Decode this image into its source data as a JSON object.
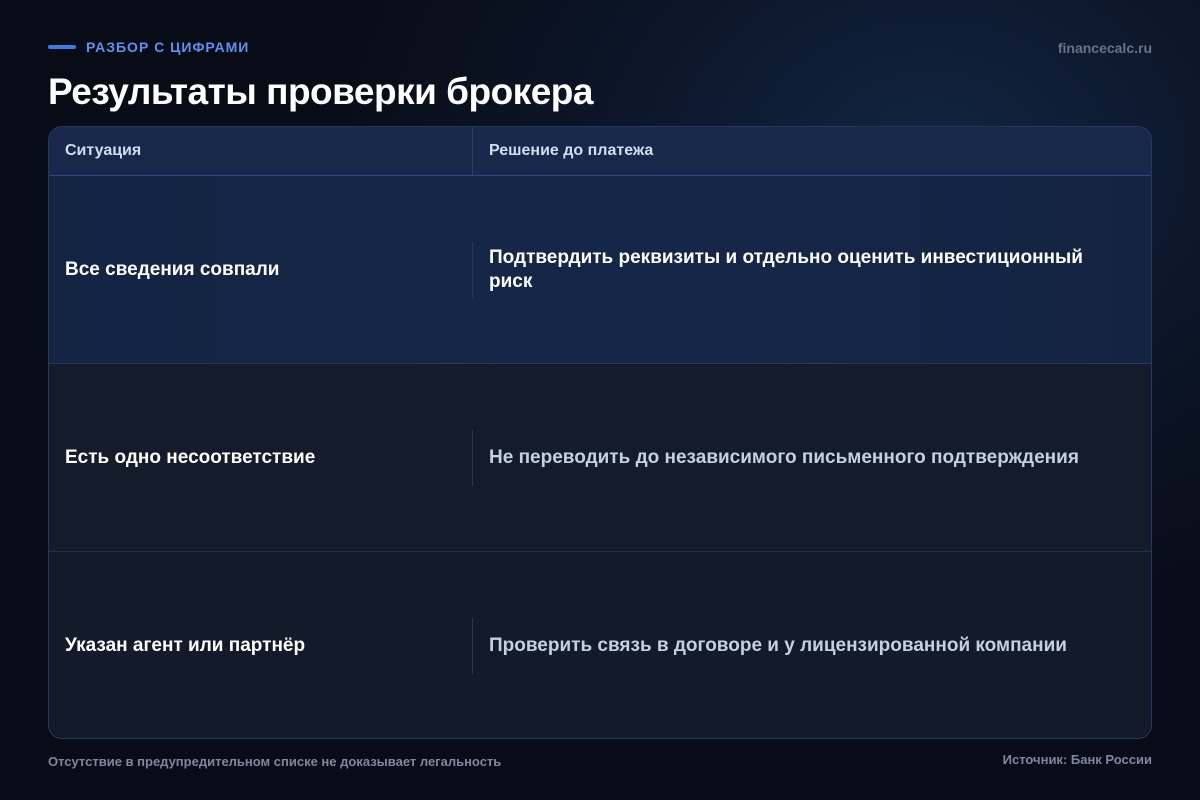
{
  "header": {
    "eyebrow": "РАЗБОР С ЦИФРАМИ",
    "site": "financecalc.ru",
    "title": "Результаты проверки брокера"
  },
  "table": {
    "columns": [
      "Ситуация",
      "Решение до платежа"
    ],
    "rows": [
      {
        "situation": "Все сведения совпали",
        "decision": "Подтвердить реквизиты и отдельно оценить инвестиционный риск"
      },
      {
        "situation": "Есть одно несоответствие",
        "decision": "Не переводить до независимого письменного подтверждения"
      },
      {
        "situation": "Указан агент или партнёр",
        "decision": "Проверить связь в договоре и у лицензированной компании"
      }
    ]
  },
  "footer": {
    "note": "Отсутствие в предупредительном списке не доказывает легальность",
    "source": "Источник: Банк России"
  },
  "colors": {
    "accent": "#3d7be6",
    "background": "#080c16",
    "highlight_row": "#152749"
  }
}
